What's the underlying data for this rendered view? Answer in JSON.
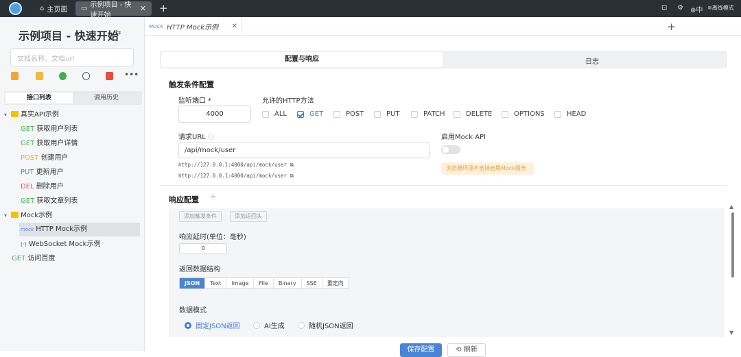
{
  "topbar": {
    "home_tab": "主页面",
    "active_tab": "示例项目 - 快速开始",
    "right_lang": "中",
    "right_mode": "离线模式"
  },
  "sidebar": {
    "project_title": "示例项目 - 快速开始",
    "search_placeholder": "文档名称、文档url",
    "seg_tabs": [
      "接口列表",
      "调用历史"
    ],
    "tree": [
      {
        "type": "folder",
        "label": "真实API示例"
      },
      {
        "method": "GET",
        "label": "获取用户列表"
      },
      {
        "method": "GET",
        "label": "获取用户详情"
      },
      {
        "method": "POST",
        "label": "创建用户"
      },
      {
        "method": "PUT",
        "label": "更新用户"
      },
      {
        "method": "DEL",
        "label": "删除用户"
      },
      {
        "method": "GET",
        "label": "获取文章列表"
      },
      {
        "type": "folder",
        "label": "Mock示例"
      },
      {
        "method": "mock",
        "label": "HTTP Mock示例"
      },
      {
        "method": "(·)",
        "label": "WebSocket Mock示例"
      },
      {
        "method": "GET",
        "label": "访问百度"
      }
    ]
  },
  "doctab": {
    "badge": "MOCK",
    "label": "HTTP Mock示例"
  },
  "content": {
    "tabs": [
      "配置与响应",
      "日志"
    ],
    "trigger_title": "触发条件配置",
    "port_label": "监听端口 *",
    "port_value": "4000",
    "methods_label": "允许的HTTP方法",
    "methods": [
      {
        "label": "ALL",
        "checked": false
      },
      {
        "label": "GET",
        "checked": true
      },
      {
        "label": "POST",
        "checked": false
      },
      {
        "label": "PUT",
        "checked": false
      },
      {
        "label": "PATCH",
        "checked": false
      },
      {
        "label": "DELETE",
        "checked": false
      },
      {
        "label": "OPTIONS",
        "checked": false
      },
      {
        "label": "HEAD",
        "checked": false
      }
    ],
    "url_label": "请求URL",
    "url_value": "/api/mock/user",
    "url_hint1": "http://127.0.0.1:4000/api/mock/user",
    "url_hint2": "http://127.0.0.1:4000/api/mock/user",
    "enable_label": "启用Mock API",
    "enable_on": false,
    "warn_text": "浏览器环境不支持启用Mock服务",
    "response_title": "响应配置",
    "add_condition": "添加触发条件",
    "add_header": "添加返回头",
    "delay_label": "响应延时(单位：毫秒)",
    "delay_value": "0",
    "structure_label": "返回数据结构",
    "formats": [
      "JSON",
      "Text",
      "Image",
      "File",
      "Binary",
      "SSE",
      "重定向"
    ],
    "mode_label": "数据模式",
    "modes": [
      "固定JSON返回",
      "AI生成",
      "随机JSON返回"
    ],
    "save_button": "保存配置",
    "refresh_button": "刷新"
  }
}
